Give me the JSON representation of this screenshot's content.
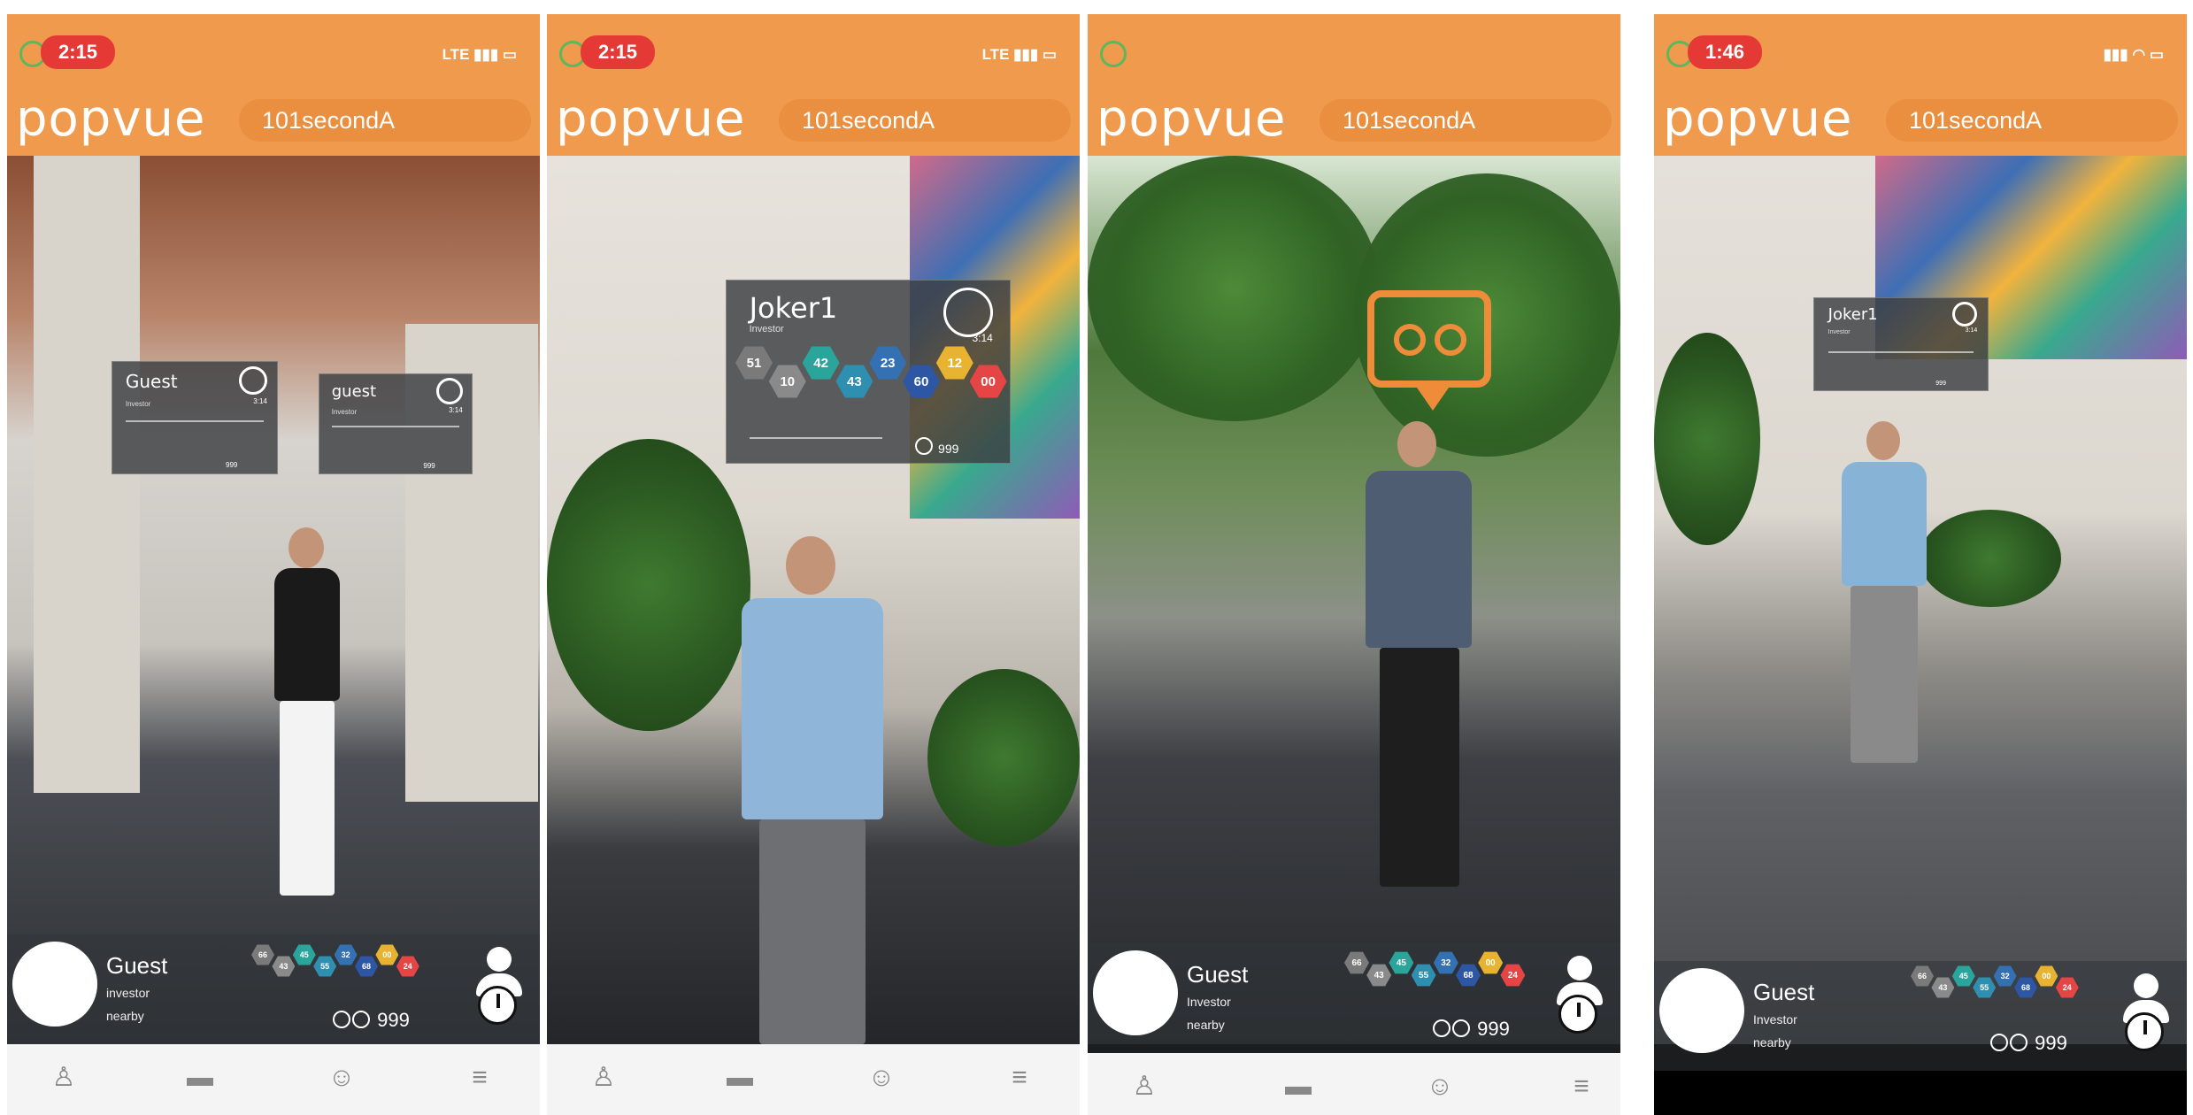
{
  "screens": [
    {
      "time": "2:15",
      "status": "LTE",
      "logo": "popvue",
      "username": "101secondA",
      "cards": [
        {
          "name": "Guest",
          "role": "Investor",
          "timer": "3:14",
          "stat": "999"
        },
        {
          "name": "guest",
          "role": "Investor",
          "timer": "3:14",
          "stat": "999"
        }
      ],
      "bottom": {
        "name": "Guest",
        "role": "investor",
        "location": "nearby",
        "score": "999",
        "hexes": [
          "66",
          "43",
          "45",
          "55",
          "32",
          "68",
          "00",
          "24"
        ]
      }
    },
    {
      "time": "2:15",
      "status": "LTE",
      "logo": "popvue",
      "username": "101secondA",
      "cards": [
        {
          "name": "Joker1",
          "role": "Investor",
          "timer": "3:14",
          "stat": "999",
          "hexes": [
            "51",
            "10",
            "42",
            "43",
            "23",
            "60",
            "12",
            "00"
          ]
        }
      ],
      "bottom": null
    },
    {
      "time": "",
      "status": "",
      "logo": "popvue",
      "username": "101secondA",
      "cards": [],
      "bottom": {
        "name": "Guest",
        "role": "Investor",
        "location": "nearby",
        "score": "999",
        "hexes": [
          "66",
          "43",
          "45",
          "55",
          "32",
          "68",
          "00",
          "24"
        ]
      }
    },
    {
      "time": "1:46",
      "status": "",
      "logo": "popvue",
      "username": "101secondA",
      "cards": [
        {
          "name": "Joker1",
          "role": "Investor",
          "timer": "3:14",
          "stat": "999"
        }
      ],
      "bottom": {
        "name": "Guest",
        "role": "Investor",
        "location": "nearby",
        "score": "999",
        "hexes": [
          "66",
          "43",
          "45",
          "55",
          "32",
          "68",
          "00",
          "24"
        ]
      }
    }
  ],
  "hex_colors": [
    "#7a7a7a",
    "#8a8a8a",
    "#2aa59b",
    "#2e8fb0",
    "#3471b2",
    "#2d56a4",
    "#e8b330",
    "#e64545"
  ],
  "nav_icons": [
    "profile-icon",
    "chat-icon",
    "group-icon",
    "menu-icon"
  ]
}
